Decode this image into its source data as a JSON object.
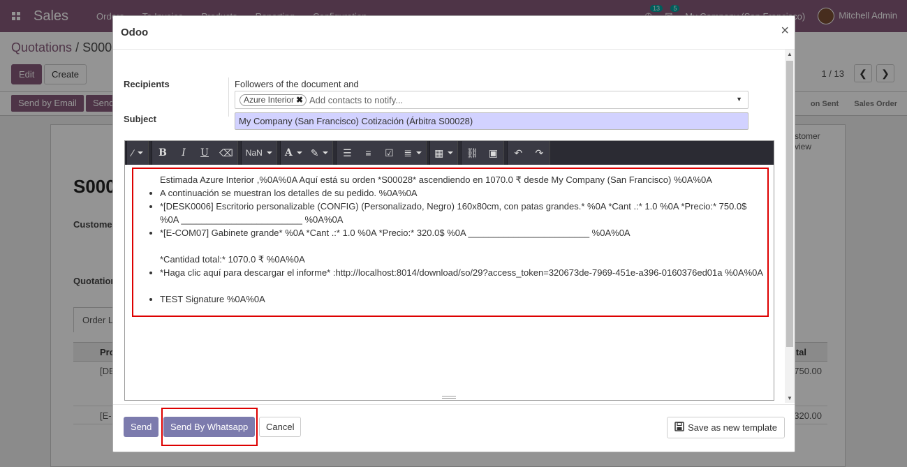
{
  "app": {
    "brand": "Sales",
    "menu": [
      "Orders",
      "To Invoice",
      "Products",
      "Reporting",
      "Configuration"
    ],
    "activity_count": "13",
    "message_count": "5",
    "company": "My Company (San Francisco)",
    "user": "Mitchell Admin"
  },
  "control_panel": {
    "breadcrumb_root": "Quotations",
    "breadcrumb_sep": " / ",
    "breadcrumb_current": "S000",
    "edit_label": "Edit",
    "create_label": "Create",
    "pager_value": "1 / 13",
    "pager_prev": "❮",
    "pager_next": "❯"
  },
  "status_bar": {
    "send_email_label": "Send by Email",
    "send_label": "Send",
    "stage_sent": "on Sent",
    "stage_order": "Sales Order"
  },
  "form": {
    "title": "S000",
    "customer_label": "Custome",
    "quotation_label": "Quotation",
    "tab_label": "Order L",
    "col_product": "Pro",
    "col_total": "tal",
    "row1_product": "[DE",
    "row1_total": "750.00",
    "row2_product": "[E-",
    "row2_total": "320.00",
    "customer_preview": "stomer\nview"
  },
  "modal": {
    "title": "Odoo",
    "close": "×",
    "recipients_label": "Recipients",
    "followers_text": "Followers of the document and",
    "tag_label": "Azure Interior",
    "tag_remove": "✖",
    "contacts_placeholder": "Add contacts to notify...",
    "subject_label": "Subject",
    "subject_value": "My Company (San Francisco) Cotización (Árbitra S00028)",
    "toolbar": {
      "font_size": "NaN"
    },
    "body": {
      "intro": "Estimada Azure Interior ,%0A%0A Aquí está su orden *S00028* ascendiendo en 1070.0 ₹ desde My Company (San Francisco) %0A%0A",
      "li1": "A continuación se muestran los detalles de su pedido. %0A%0A",
      "li2": "*[DESK0006] Escritorio personalizable (CONFIG) (Personalizado, Negro) 160x80cm, con patas grandes.* %0A *Cant .:* 1.0 %0A *Precio:* 750.0$ %0A ________________________ %0A%0A",
      "li3": "*[E-COM07] Gabinete grande* %0A *Cant .:* 1.0 %0A *Precio:* 320.0$ %0A ________________________ %0A%0A",
      "total": "*Cantidad total:* 1070.0 ₹ %0A%0A",
      "li4": "*Haga clic aquí para descargar el informe* :http://localhost:8014/download/so/29?access_token=320673de-7969-451e-a396-0160376ed01a %0A%0A",
      "li5": "TEST Signature %0A%0A"
    },
    "footer": {
      "send_label": "Send",
      "whatsapp_label": "Send By Whatsapp",
      "cancel_label": "Cancel",
      "save_template_label": "Save as new template"
    }
  }
}
